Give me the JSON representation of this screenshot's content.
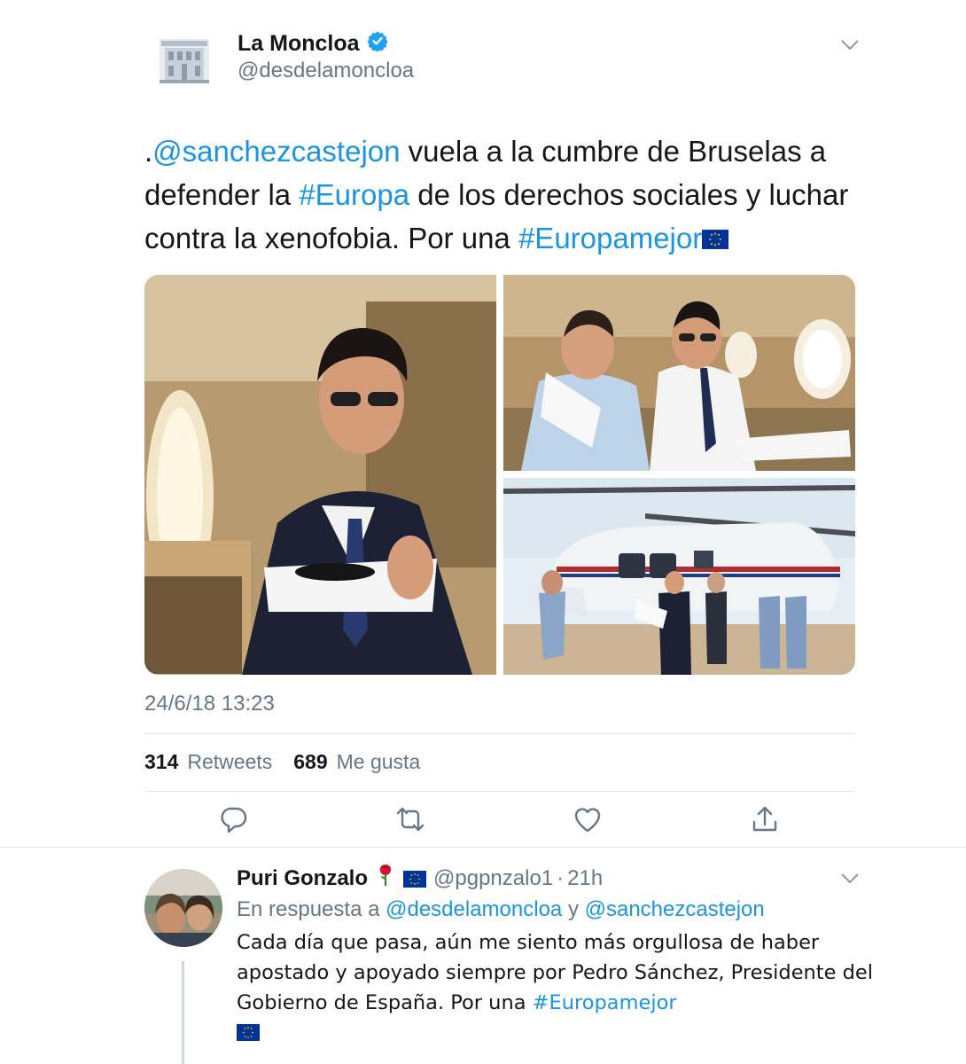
{
  "tweet": {
    "author_name": "La Moncloa",
    "author_handle": "@desdelamoncloa",
    "text_parts": [
      {
        "text": ".",
        "type": "plain"
      },
      {
        "text": "@sanchezcastejon",
        "type": "link"
      },
      {
        "text": " vuela a la cumbre de Bruselas a defender la ",
        "type": "plain"
      },
      {
        "text": "#Europa",
        "type": "link"
      },
      {
        "text": " de los derechos sociales y luchar contra la xenofobia. Por una ",
        "type": "plain"
      },
      {
        "text": "#Europamejor",
        "type": "link"
      }
    ],
    "timestamp": "24/6/18 13:23",
    "retweets_count": "314",
    "retweets_label": "Retweets",
    "likes_count": "689",
    "likes_label": "Me gusta"
  },
  "actions": [
    {
      "icon": "reply-icon"
    },
    {
      "icon": "retweet-icon"
    },
    {
      "icon": "like-icon"
    },
    {
      "icon": "share-icon"
    }
  ],
  "reply": {
    "author_name": "Puri Gonzalo",
    "author_handle": "@pgpnzalo1",
    "separator": "·",
    "time": "21h",
    "in_reply_prefix": "En respuesta a",
    "in_reply_user1": "@desdelamoncloa",
    "in_reply_and": "y",
    "in_reply_user2": "@sanchezcastejon",
    "body_plain": "Cada día que pasa, aún me siento más orgullosa de haber apostado y apoyado siempre por Pedro Sánchez, Presidente del Gobierno de España. Por una ",
    "body_hashtag": "#Europamejor"
  },
  "colors": {
    "link": "#1b95e0",
    "verified": "#1da1f2",
    "secondary_text": "#657786",
    "divider": "#e1e8ed",
    "eu_blue": "#003399",
    "eu_star": "#ffcc00"
  }
}
